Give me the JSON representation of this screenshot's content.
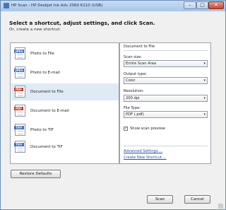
{
  "window": {
    "title": "HP Scan - HP Deskjet Ink Adv 2060 K110 (USB)"
  },
  "titlebar_buttons": {
    "minimize": "–",
    "maximize": "□",
    "close": "✕"
  },
  "heading": "Select a shortcut, adjust settings, and click Scan.",
  "subheading": "Or, create a new shortcut.",
  "shortcuts": [
    {
      "label": "Photo to File",
      "badge": "JPEG",
      "badge_color": "#3a6cc0",
      "icon": "jpeg-file-icon"
    },
    {
      "label": "Photo to E-mail",
      "badge": "JPEG",
      "badge_color": "#3a6cc0",
      "icon": "jpeg-email-icon"
    },
    {
      "label": "Document to File",
      "badge": "PDF",
      "badge_color": "#c23a2a",
      "icon": "pdf-file-icon",
      "selected": true
    },
    {
      "label": "Document to E-mail",
      "badge": "PDF",
      "badge_color": "#c23a2a",
      "icon": "pdf-email-icon"
    },
    {
      "label": "Photo to TIF",
      "badge": "TIFF",
      "badge_color": "#3a6cc0",
      "icon": "tiff-file-icon"
    },
    {
      "label": "Document to TIF",
      "badge": "TIFF",
      "badge_color": "#3a6cc0",
      "icon": "tiff-file-icon"
    }
  ],
  "settings": {
    "title": "Document to File",
    "scan_size": {
      "label": "Scan size:",
      "value": "Entire Scan Area"
    },
    "output_type": {
      "label": "Output type:",
      "value": "Color"
    },
    "resolution": {
      "label": "Resolution:",
      "value": "200 dpi"
    },
    "file_type": {
      "label": "File Type:",
      "value": "PDF (.pdf)"
    },
    "show_preview": {
      "label": "Show scan preview",
      "checked": true
    },
    "advanced_link": "Advanced Settings....",
    "new_shortcut_link": "Create New Shortcut...."
  },
  "buttons": {
    "restore": "Restore Defaults",
    "scan": "Scan",
    "cancel": "Cancel"
  },
  "colors": {
    "titlebar": "#b6cfec",
    "selection": "#dfeaf7",
    "link": "#2450a8"
  }
}
